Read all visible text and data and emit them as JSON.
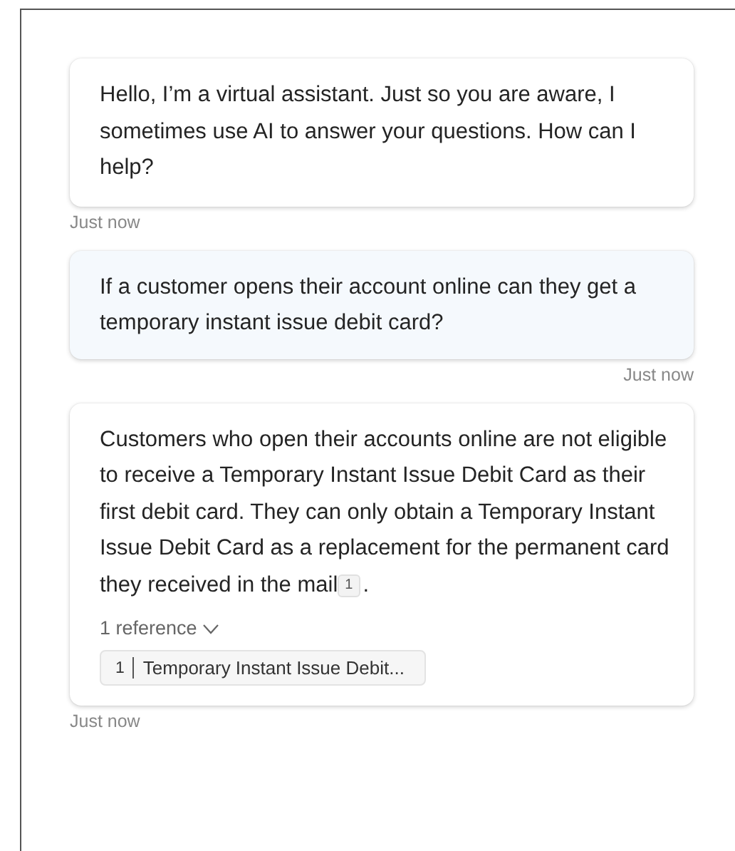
{
  "messages": [
    {
      "kind": "bot",
      "text": "Hello, I’m a virtual assistant. Just so you are aware, I sometimes use AI to answer your questions. How can I help?",
      "time": "Just now"
    },
    {
      "kind": "user",
      "text": "If a customer opens their account online can they get a temporary instant issue debit card?",
      "time": "Just now"
    },
    {
      "kind": "bot",
      "text": "Customers who open their accounts online are not eligible to receive a Temporary Instant Issue Debit Card as their first debit card. They can only obtain a Temporary Instant Issue Debit Card as a replacement for the permanent card they received in the mail",
      "citation": "1",
      "after": ".",
      "references_toggle": {
        "label": "1 reference",
        "expanded": false
      },
      "references": [
        {
          "number": "1",
          "title": "Temporary Instant Issue Debit..."
        }
      ],
      "time": "Just now"
    }
  ]
}
